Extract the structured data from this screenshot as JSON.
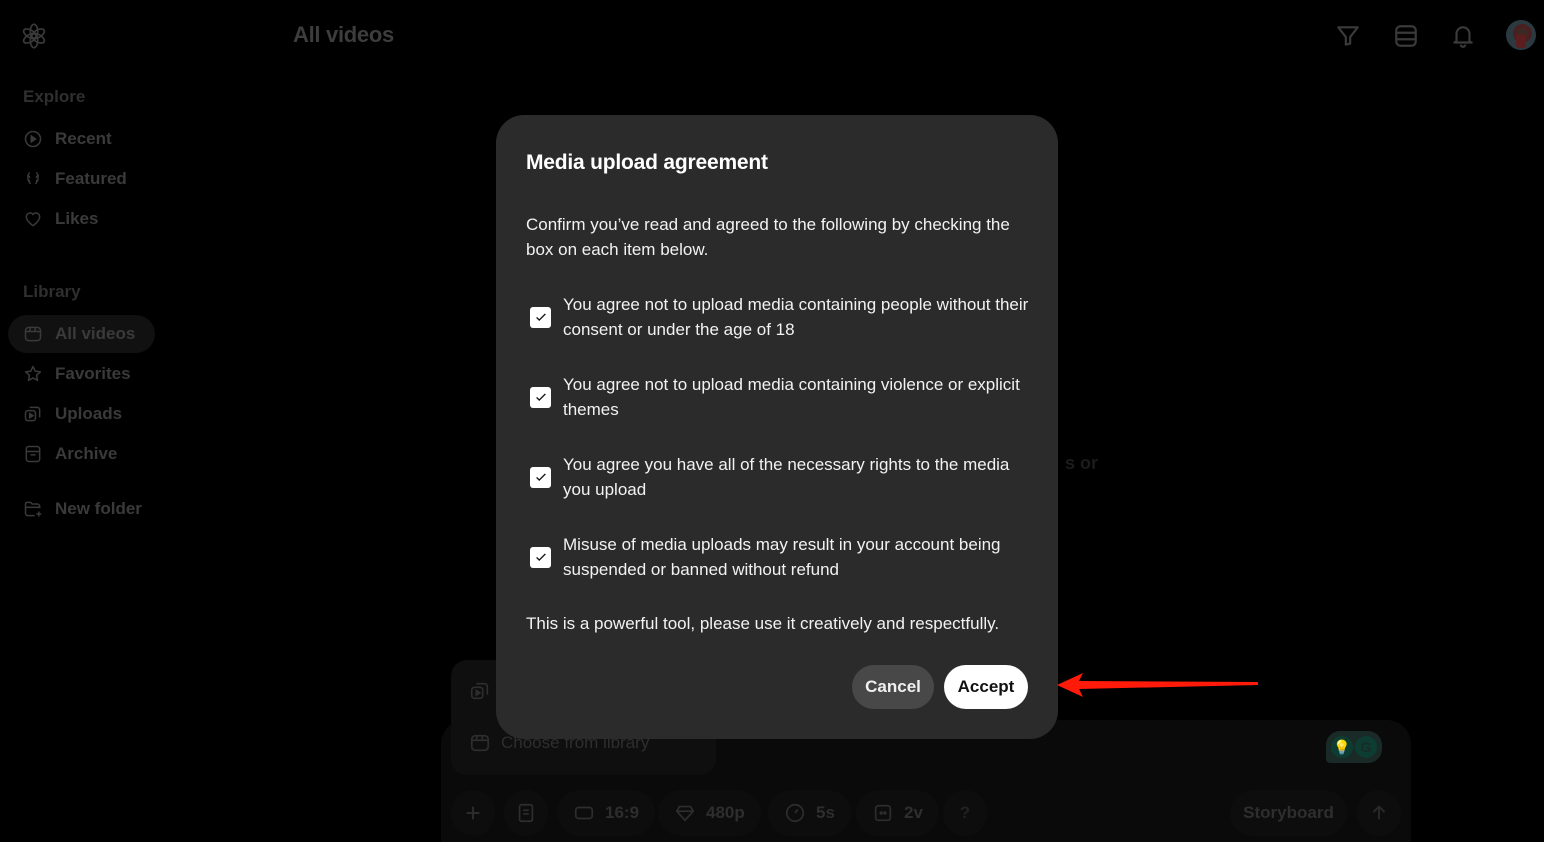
{
  "header": {
    "title": "All videos",
    "icons": [
      "filter-icon",
      "list-view-icon",
      "bell-icon"
    ],
    "avatar_label": "user-avatar"
  },
  "sidebar": {
    "explore_label": "Explore",
    "explore_items": [
      {
        "label": "Recent",
        "icon": "play-circle-icon"
      },
      {
        "label": "Featured",
        "icon": "laurel-icon"
      },
      {
        "label": "Likes",
        "icon": "heart-icon"
      }
    ],
    "library_label": "Library",
    "library_items": [
      {
        "label": "All videos",
        "icon": "clapperboard-icon",
        "active": true
      },
      {
        "label": "Favorites",
        "icon": "star-icon"
      },
      {
        "label": "Uploads",
        "icon": "uploads-icon"
      },
      {
        "label": "Archive",
        "icon": "archive-icon"
      }
    ],
    "new_folder_label": "New folder"
  },
  "background": {
    "ghost_text": "s or",
    "upload_menu": {
      "upload_label": "",
      "library_label": "Choose from library"
    },
    "composer": {
      "aspect_ratio": "16:9",
      "resolution": "480p",
      "duration": "5s",
      "variations": "2v",
      "help_label": "?",
      "storyboard_label": "Storyboard"
    }
  },
  "modal": {
    "title": "Media upload agreement",
    "description": "Confirm you’ve read and agreed to the following by checking the box on each item below.",
    "items": [
      {
        "text": "You agree not to upload media containing people without their consent or under the age of 18",
        "checked": true
      },
      {
        "text": "You agree not to upload media containing violence or explicit themes",
        "checked": true
      },
      {
        "text": "You agree you have all of the necessary rights to the media you upload",
        "checked": true
      },
      {
        "text": "Misuse of media uploads may result in your account being suspended or banned without refund",
        "checked": true
      }
    ],
    "footer_text": "This is a powerful tool, please use it creatively and respectfully.",
    "cancel_label": "Cancel",
    "accept_label": "Accept"
  },
  "annotation": {
    "arrow_color": "#ff1a0a",
    "points_to": "accept-button"
  },
  "colors": {
    "modal_bg": "#2b2b2b",
    "accept_bg": "#ffffff",
    "cancel_bg": "#484848"
  }
}
